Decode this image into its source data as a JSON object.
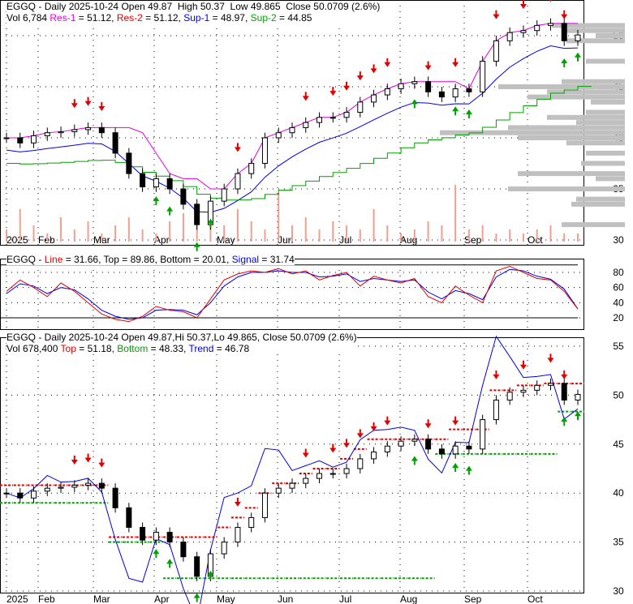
{
  "panel1": {
    "line1": {
      "symbol": "EGGQ",
      "period": "Daily",
      "date": "2025-10-24",
      "open": "Open 49.87",
      "high": "High 50.37",
      "low": "Low 49.865",
      "close": "Close 50.0709 (2.6%)"
    },
    "line2": {
      "vol": "Vol 6,784",
      "res1_label": "Res-1",
      "res1": "= 51.12,",
      "res2_label": "Res-2",
      "res2": "= 51.12,",
      "sup1_label": "Sup-1",
      "sup1": "= 48.97,",
      "sup2_label": "Sup-2",
      "sup2": "= 44.85"
    }
  },
  "panel2": {
    "symbol": "EGGQ -",
    "line_label": "Line",
    "line": "= 31.66, Top = 89.86, Bottom = 20.01,",
    "signal_label": "Signal",
    "signal": "= 31.74"
  },
  "panel3": {
    "line1": "EGGQ - Daily 2025-10-24 Open 49.87,Hi 50.37,Lo 49.865, Close 50.0709 (2.6%)",
    "vol": "Vol 678,400",
    "top_label": "Top",
    "top": "= 51.18,",
    "bottom_label": "Bottom",
    "bottom": "= 48.33,",
    "trend_label": "Trend",
    "trend": "= 46.78"
  },
  "colors": {
    "res1": "#e000e0",
    "res2": "#e00000",
    "sup1": "#0000e0",
    "sup2": "#00a000",
    "volume": "#f0a090",
    "profile": "#c0c0c0"
  },
  "chart_data": [
    {
      "type": "candlestick",
      "title": "EGGQ - Daily",
      "x_labels": [
        "2025",
        "Feb",
        "Mar",
        "Apr",
        "May",
        "Jun",
        "Jul",
        "Aug",
        "Sep",
        "Oct"
      ],
      "y_ticks": [
        30,
        35,
        40,
        45,
        50
      ],
      "ylim": [
        30,
        52
      ],
      "weekly_close": [
        40,
        39.5,
        40.2,
        40.5,
        40.6,
        40.8,
        41,
        40.5,
        38.5,
        36.5,
        35.2,
        36,
        35,
        33.5,
        31.5,
        33.8,
        35,
        36.5,
        37.5,
        40,
        40.5,
        41,
        41.5,
        42,
        42,
        42.5,
        43.5,
        44.2,
        44.8,
        45.3,
        45.5,
        44.5,
        44,
        44.8,
        44.5,
        47.5,
        49.5,
        50.3,
        50.5,
        51,
        51.2,
        49.5,
        50.07
      ],
      "weekly_volume": [
        3,
        8,
        4,
        2,
        6,
        3,
        5,
        2,
        4,
        6,
        3,
        2,
        5,
        7,
        9,
        6,
        4,
        8,
        5,
        3,
        12,
        4,
        6,
        3,
        5,
        4,
        3,
        8,
        4,
        2,
        3,
        5,
        4,
        14,
        3,
        4,
        2,
        3,
        2,
        3,
        4,
        2,
        2
      ],
      "sell_arrows": [
        5,
        6,
        7,
        17,
        22,
        24,
        25,
        26,
        27,
        28,
        31,
        33,
        36,
        38,
        40,
        41
      ],
      "buy_arrows": [
        11,
        12,
        14,
        15,
        30,
        33,
        34,
        41,
        42
      ]
    },
    {
      "type": "line",
      "title": "EGGQ - Line / Signal",
      "y_ticks": [
        20,
        40,
        60,
        80
      ],
      "ylim": [
        10,
        95
      ],
      "line": [
        55,
        70,
        60,
        48,
        66,
        55,
        40,
        25,
        18,
        15,
        22,
        35,
        30,
        28,
        20,
        45,
        70,
        78,
        82,
        80,
        85,
        78,
        82,
        70,
        76,
        80,
        62,
        75,
        70,
        66,
        72,
        48,
        40,
        62,
        50,
        40,
        82,
        88,
        80,
        72,
        70,
        55,
        31.66
      ],
      "signal": [
        52,
        65,
        62,
        52,
        60,
        57,
        45,
        30,
        22,
        18,
        20,
        30,
        31,
        30,
        24,
        40,
        62,
        74,
        80,
        80,
        82,
        80,
        80,
        74,
        75,
        78,
        68,
        72,
        70,
        68,
        70,
        54,
        45,
        56,
        52,
        44,
        74,
        84,
        82,
        75,
        71,
        58,
        31.74
      ],
      "top": 89.86,
      "bottom": 20.01
    },
    {
      "type": "candlestick",
      "title": "EGGQ - Daily Top/Bottom/Trend",
      "y_ticks": [
        30,
        35,
        40,
        45,
        50,
        55
      ],
      "ylim": [
        30,
        55
      ],
      "top_levels": [
        40.8,
        40.8,
        40.8,
        40.8,
        40.8,
        40.8,
        40.8,
        40.8,
        35.5,
        35.5,
        35.5,
        35.5,
        35.5,
        35.5,
        35.5,
        35.5,
        36.5,
        37.5,
        38.5,
        40,
        41,
        41,
        42,
        42.5,
        42.5,
        43.5,
        44.5,
        45.5,
        45.5,
        45.5,
        45.5,
        45.5,
        45.5,
        46.5,
        46.5,
        46.5,
        50.5,
        50.5,
        51,
        51,
        51.2,
        51.18,
        51.18
      ],
      "bottom_levels": [
        39,
        39,
        39,
        39,
        39,
        39,
        39,
        39,
        35,
        35,
        35,
        35,
        31.3,
        31.3,
        31.3,
        31.3,
        31.3,
        31.3,
        31.3,
        31.3,
        31.3,
        31.3,
        31.3,
        31.3,
        31.3,
        31.3,
        31.3,
        31.3,
        31.3,
        31.3,
        31.3,
        31.3,
        44,
        44,
        44,
        44,
        44,
        44,
        44,
        44,
        44,
        48.33,
        48.33
      ]
    }
  ]
}
